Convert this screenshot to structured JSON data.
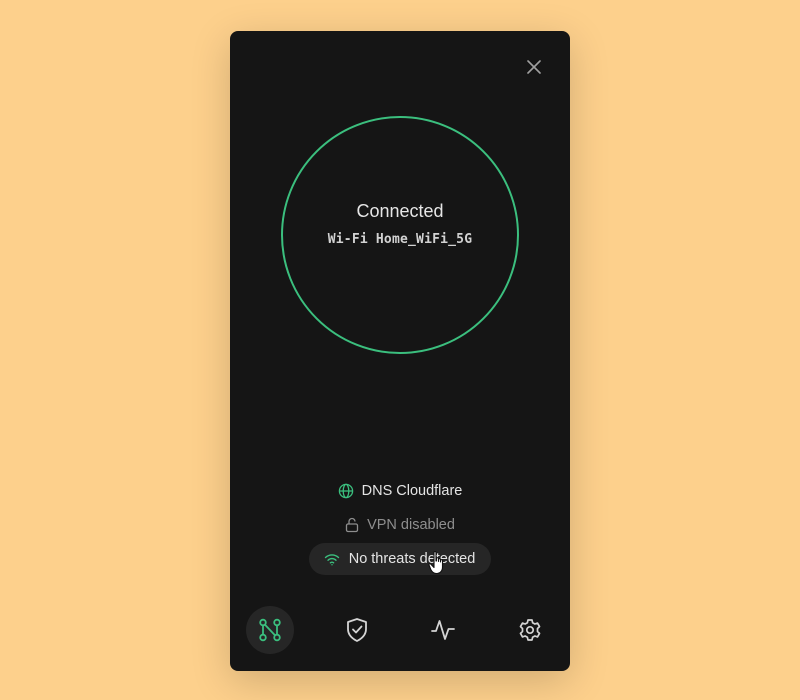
{
  "status": {
    "title": "Connected",
    "network": "Wi-Fi Home_WiFi_5G"
  },
  "info": {
    "dns": "DNS Cloudflare",
    "vpn": "VPN disabled",
    "threats": "No threats detected"
  },
  "colors": {
    "accent": "#3bbf7e",
    "background": "#fdd08c",
    "panel": "#151515"
  },
  "icons": {
    "close": "close-icon",
    "dns": "globe-icon",
    "vpn": "lock-icon",
    "threats": "wifi-icon",
    "nav_network": "network-nodes-icon",
    "nav_protection": "shield-check-icon",
    "nav_activity": "activity-icon",
    "nav_settings": "gear-icon"
  },
  "nav": {
    "active": "network"
  }
}
